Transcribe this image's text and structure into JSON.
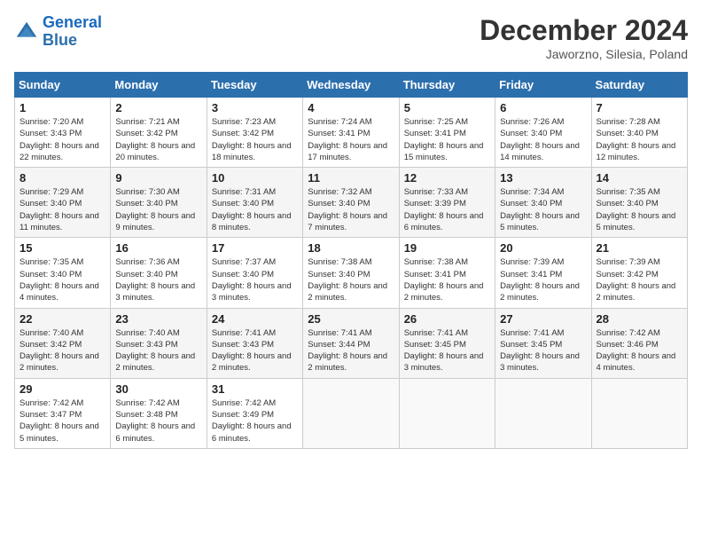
{
  "header": {
    "logo_line1": "General",
    "logo_line2": "Blue",
    "month_title": "December 2024",
    "location": "Jaworzno, Silesia, Poland"
  },
  "weekdays": [
    "Sunday",
    "Monday",
    "Tuesday",
    "Wednesday",
    "Thursday",
    "Friday",
    "Saturday"
  ],
  "weeks": [
    [
      {
        "day": "1",
        "sunrise": "Sunrise: 7:20 AM",
        "sunset": "Sunset: 3:43 PM",
        "daylight": "Daylight: 8 hours and 22 minutes."
      },
      {
        "day": "2",
        "sunrise": "Sunrise: 7:21 AM",
        "sunset": "Sunset: 3:42 PM",
        "daylight": "Daylight: 8 hours and 20 minutes."
      },
      {
        "day": "3",
        "sunrise": "Sunrise: 7:23 AM",
        "sunset": "Sunset: 3:42 PM",
        "daylight": "Daylight: 8 hours and 18 minutes."
      },
      {
        "day": "4",
        "sunrise": "Sunrise: 7:24 AM",
        "sunset": "Sunset: 3:41 PM",
        "daylight": "Daylight: 8 hours and 17 minutes."
      },
      {
        "day": "5",
        "sunrise": "Sunrise: 7:25 AM",
        "sunset": "Sunset: 3:41 PM",
        "daylight": "Daylight: 8 hours and 15 minutes."
      },
      {
        "day": "6",
        "sunrise": "Sunrise: 7:26 AM",
        "sunset": "Sunset: 3:40 PM",
        "daylight": "Daylight: 8 hours and 14 minutes."
      },
      {
        "day": "7",
        "sunrise": "Sunrise: 7:28 AM",
        "sunset": "Sunset: 3:40 PM",
        "daylight": "Daylight: 8 hours and 12 minutes."
      }
    ],
    [
      {
        "day": "8",
        "sunrise": "Sunrise: 7:29 AM",
        "sunset": "Sunset: 3:40 PM",
        "daylight": "Daylight: 8 hours and 11 minutes."
      },
      {
        "day": "9",
        "sunrise": "Sunrise: 7:30 AM",
        "sunset": "Sunset: 3:40 PM",
        "daylight": "Daylight: 8 hours and 9 minutes."
      },
      {
        "day": "10",
        "sunrise": "Sunrise: 7:31 AM",
        "sunset": "Sunset: 3:40 PM",
        "daylight": "Daylight: 8 hours and 8 minutes."
      },
      {
        "day": "11",
        "sunrise": "Sunrise: 7:32 AM",
        "sunset": "Sunset: 3:40 PM",
        "daylight": "Daylight: 8 hours and 7 minutes."
      },
      {
        "day": "12",
        "sunrise": "Sunrise: 7:33 AM",
        "sunset": "Sunset: 3:39 PM",
        "daylight": "Daylight: 8 hours and 6 minutes."
      },
      {
        "day": "13",
        "sunrise": "Sunrise: 7:34 AM",
        "sunset": "Sunset: 3:40 PM",
        "daylight": "Daylight: 8 hours and 5 minutes."
      },
      {
        "day": "14",
        "sunrise": "Sunrise: 7:35 AM",
        "sunset": "Sunset: 3:40 PM",
        "daylight": "Daylight: 8 hours and 5 minutes."
      }
    ],
    [
      {
        "day": "15",
        "sunrise": "Sunrise: 7:35 AM",
        "sunset": "Sunset: 3:40 PM",
        "daylight": "Daylight: 8 hours and 4 minutes."
      },
      {
        "day": "16",
        "sunrise": "Sunrise: 7:36 AM",
        "sunset": "Sunset: 3:40 PM",
        "daylight": "Daylight: 8 hours and 3 minutes."
      },
      {
        "day": "17",
        "sunrise": "Sunrise: 7:37 AM",
        "sunset": "Sunset: 3:40 PM",
        "daylight": "Daylight: 8 hours and 3 minutes."
      },
      {
        "day": "18",
        "sunrise": "Sunrise: 7:38 AM",
        "sunset": "Sunset: 3:40 PM",
        "daylight": "Daylight: 8 hours and 2 minutes."
      },
      {
        "day": "19",
        "sunrise": "Sunrise: 7:38 AM",
        "sunset": "Sunset: 3:41 PM",
        "daylight": "Daylight: 8 hours and 2 minutes."
      },
      {
        "day": "20",
        "sunrise": "Sunrise: 7:39 AM",
        "sunset": "Sunset: 3:41 PM",
        "daylight": "Daylight: 8 hours and 2 minutes."
      },
      {
        "day": "21",
        "sunrise": "Sunrise: 7:39 AM",
        "sunset": "Sunset: 3:42 PM",
        "daylight": "Daylight: 8 hours and 2 minutes."
      }
    ],
    [
      {
        "day": "22",
        "sunrise": "Sunrise: 7:40 AM",
        "sunset": "Sunset: 3:42 PM",
        "daylight": "Daylight: 8 hours and 2 minutes."
      },
      {
        "day": "23",
        "sunrise": "Sunrise: 7:40 AM",
        "sunset": "Sunset: 3:43 PM",
        "daylight": "Daylight: 8 hours and 2 minutes."
      },
      {
        "day": "24",
        "sunrise": "Sunrise: 7:41 AM",
        "sunset": "Sunset: 3:43 PM",
        "daylight": "Daylight: 8 hours and 2 minutes."
      },
      {
        "day": "25",
        "sunrise": "Sunrise: 7:41 AM",
        "sunset": "Sunset: 3:44 PM",
        "daylight": "Daylight: 8 hours and 2 minutes."
      },
      {
        "day": "26",
        "sunrise": "Sunrise: 7:41 AM",
        "sunset": "Sunset: 3:45 PM",
        "daylight": "Daylight: 8 hours and 3 minutes."
      },
      {
        "day": "27",
        "sunrise": "Sunrise: 7:41 AM",
        "sunset": "Sunset: 3:45 PM",
        "daylight": "Daylight: 8 hours and 3 minutes."
      },
      {
        "day": "28",
        "sunrise": "Sunrise: 7:42 AM",
        "sunset": "Sunset: 3:46 PM",
        "daylight": "Daylight: 8 hours and 4 minutes."
      }
    ],
    [
      {
        "day": "29",
        "sunrise": "Sunrise: 7:42 AM",
        "sunset": "Sunset: 3:47 PM",
        "daylight": "Daylight: 8 hours and 5 minutes."
      },
      {
        "day": "30",
        "sunrise": "Sunrise: 7:42 AM",
        "sunset": "Sunset: 3:48 PM",
        "daylight": "Daylight: 8 hours and 6 minutes."
      },
      {
        "day": "31",
        "sunrise": "Sunrise: 7:42 AM",
        "sunset": "Sunset: 3:49 PM",
        "daylight": "Daylight: 8 hours and 6 minutes."
      },
      null,
      null,
      null,
      null
    ]
  ]
}
